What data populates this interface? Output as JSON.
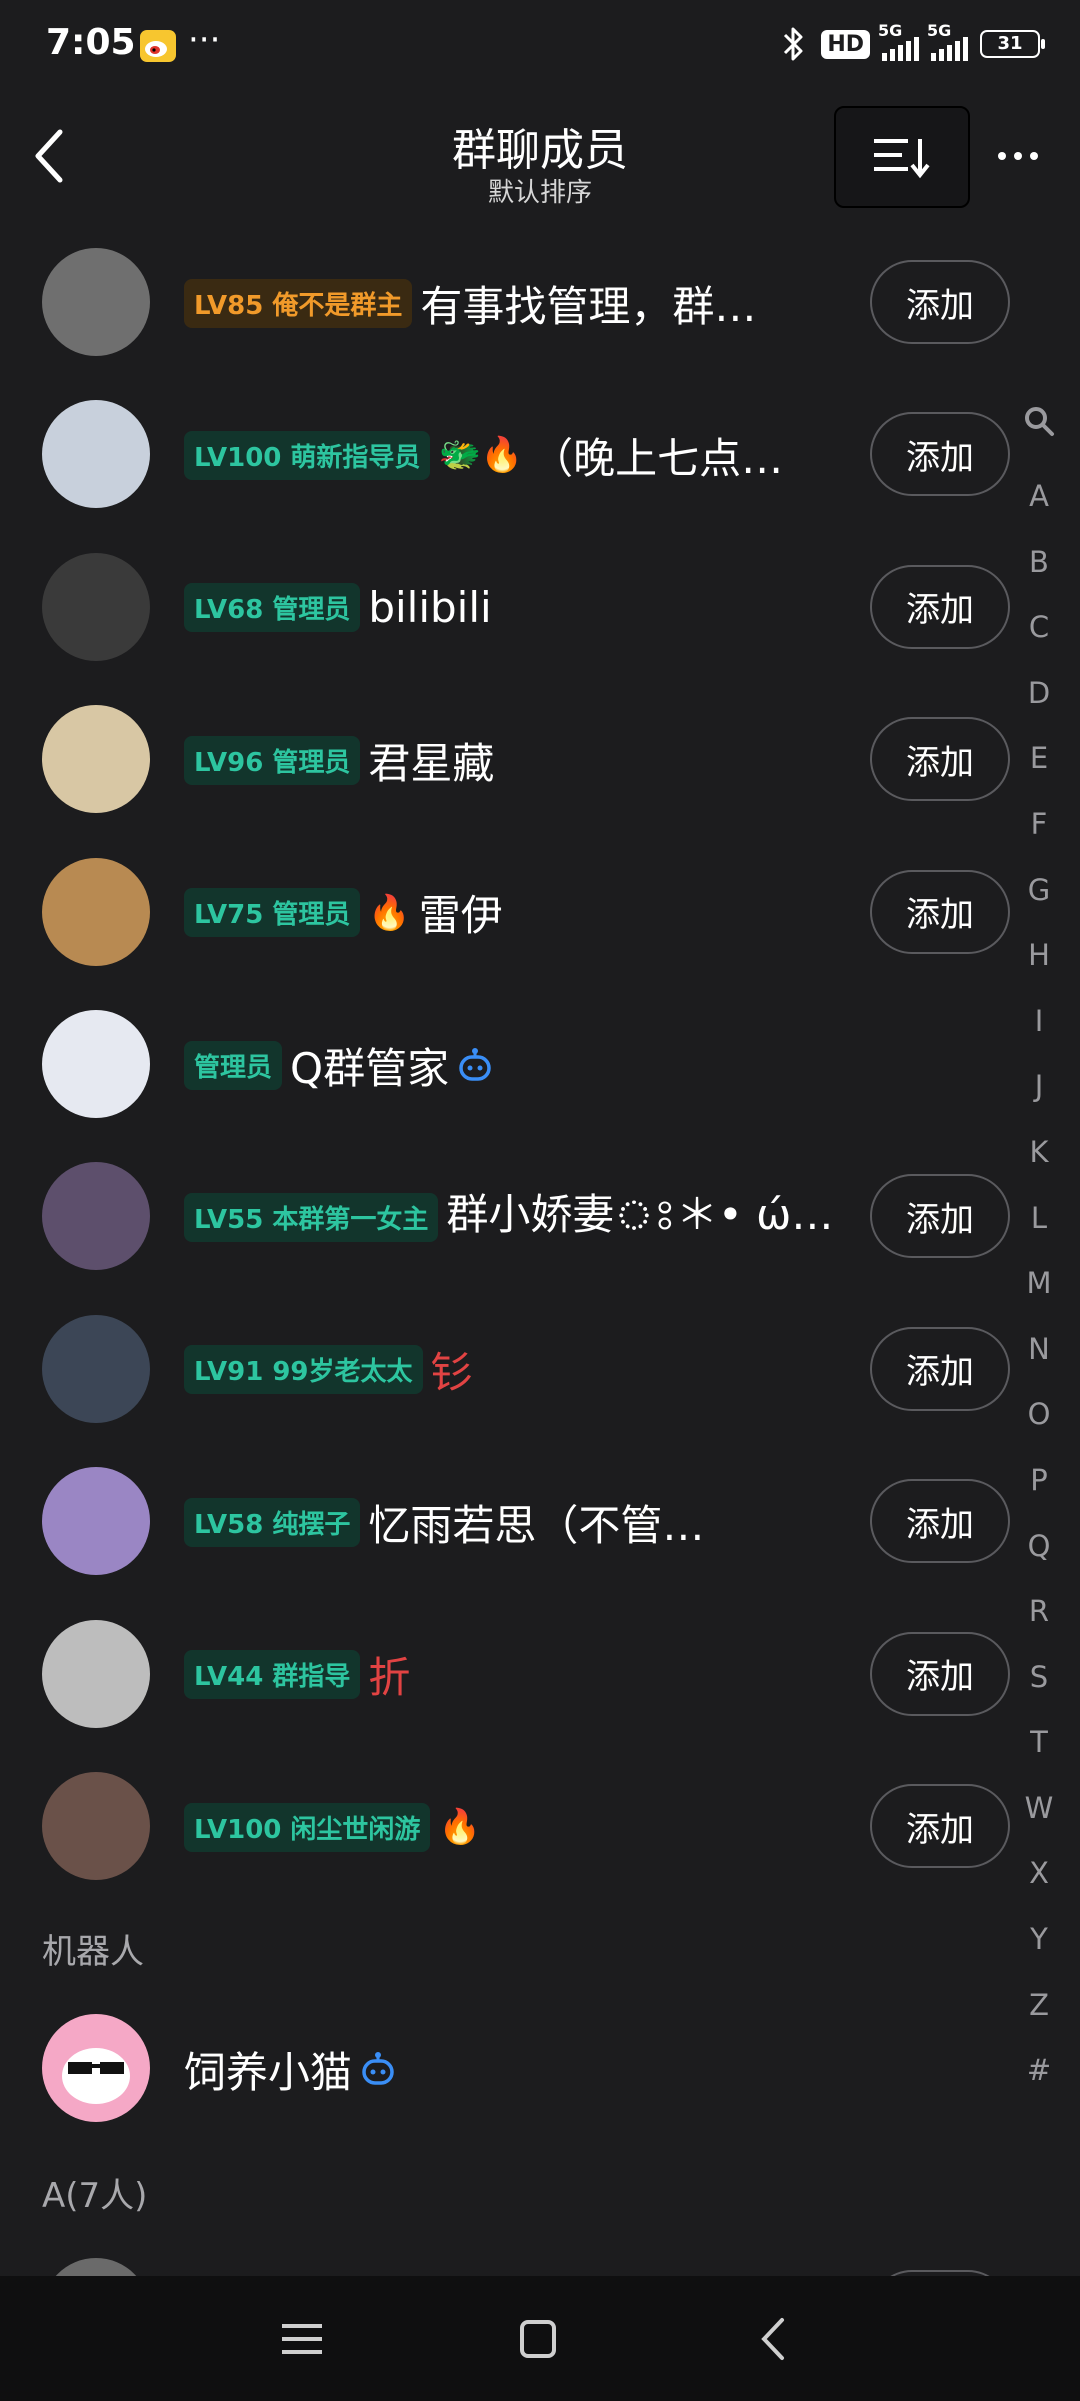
{
  "status_bar": {
    "time": "7:05",
    "more": "···",
    "hd_label": "HD",
    "network_1": "5G",
    "network_2": "5G",
    "battery": "31"
  },
  "header": {
    "title": "群聊成员",
    "subtitle": "默认排序"
  },
  "members": [
    {
      "badge": "LV85 俺不是群主",
      "badge_type": "owner",
      "name": "有事找管理，群…",
      "has_add": true,
      "add_label": "添加",
      "avatar_bg": "#6f6f6f"
    },
    {
      "badge": "LV100 萌新指导员",
      "badge_type": "normal",
      "emojis": "🐲🔥",
      "name": "（晚上七点…",
      "has_add": true,
      "add_label": "添加",
      "avatar_bg": "#c8d0dc"
    },
    {
      "badge": "LV68 管理员",
      "badge_type": "normal",
      "name": "bilibili",
      "has_add": true,
      "add_label": "添加",
      "avatar_bg": "#3a3a3a"
    },
    {
      "badge": "LV96 管理员",
      "badge_type": "normal",
      "name": "君星藏",
      "has_add": true,
      "add_label": "添加",
      "avatar_bg": "#d8c7a4"
    },
    {
      "badge": "LV75 管理员",
      "badge_type": "normal",
      "emojis": "🔥",
      "name": "雷伊",
      "has_add": true,
      "add_label": "添加",
      "avatar_bg": "#b88a52"
    },
    {
      "badge": "管理员",
      "badge_type": "normal",
      "name": "Q群管家",
      "has_robot": true,
      "has_add": false,
      "avatar_bg": "#e6e9f1"
    },
    {
      "badge": "LV55 本群第一女主",
      "badge_type": "normal",
      "name": "群小娇妻ঃ＊• ώ…",
      "has_add": true,
      "add_label": "添加",
      "avatar_bg": "#5d4f6c"
    },
    {
      "badge": "LV91 99岁老太太",
      "badge_type": "normal",
      "name": "钐",
      "name_red": true,
      "has_add": true,
      "add_label": "添加",
      "avatar_bg": "#3c4656"
    },
    {
      "badge": "LV58 纯摆子",
      "badge_type": "normal",
      "name": "忆雨若思（不管…",
      "has_add": true,
      "add_label": "添加",
      "avatar_bg": "#9a86c4"
    },
    {
      "badge": "LV44 群指导",
      "badge_type": "normal",
      "name": "折",
      "name_red": true,
      "has_add": true,
      "add_label": "添加",
      "avatar_bg": "#bdbdbd"
    },
    {
      "badge": "LV100 闲尘世闲游",
      "badge_type": "normal",
      "emojis": "🔥",
      "name": "",
      "has_add": true,
      "add_label": "添加",
      "avatar_bg": "#6a5149"
    }
  ],
  "robot_section": {
    "label": "机器人",
    "robot": {
      "name": "饲养小猫",
      "avatar_bg": "#f5a8c6"
    }
  },
  "section_a": {
    "label": "A(7人)"
  },
  "alphabet": [
    "A",
    "B",
    "C",
    "D",
    "E",
    "F",
    "G",
    "H",
    "I",
    "J",
    "K",
    "L",
    "M",
    "N",
    "O",
    "P",
    "Q",
    "R",
    "S",
    "T",
    "W",
    "X",
    "Y",
    "Z",
    "#"
  ],
  "colors": {
    "background": "#1c1c1e",
    "badge_green": "#2dc5a0",
    "badge_orange": "#f19a2a",
    "name_red": "#e24343"
  }
}
